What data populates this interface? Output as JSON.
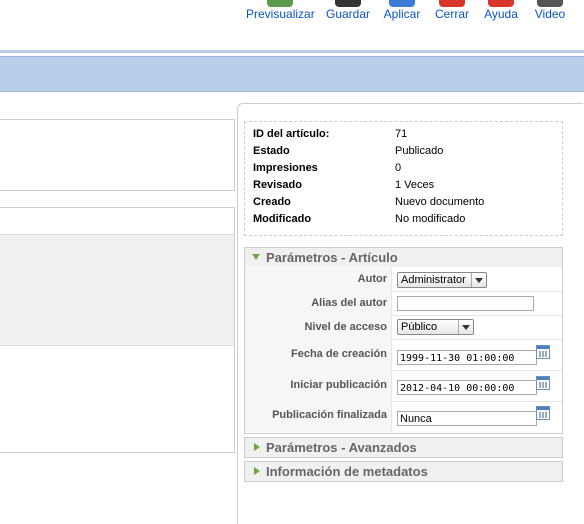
{
  "toolbar": {
    "buttons": [
      {
        "label": "Previsualizar",
        "icon": "preview-icon",
        "color": "#5a9a4a"
      },
      {
        "label": "Guardar",
        "icon": "save-icon",
        "color": "#333333"
      },
      {
        "label": "Aplicar",
        "icon": "apply-icon",
        "color": "#3a7bd5"
      },
      {
        "label": "Cerrar",
        "icon": "close-icon",
        "color": "#d9362b"
      },
      {
        "label": "Ayuda",
        "icon": "help-icon",
        "color": "#d9362b"
      },
      {
        "label": "Video",
        "icon": "video-icon",
        "color": "#555555"
      }
    ]
  },
  "info": {
    "rows": [
      {
        "key": "ID del artículo:",
        "value": "71"
      },
      {
        "key": "Estado",
        "value": "Publicado"
      },
      {
        "key": "Impresiones",
        "value": "0"
      },
      {
        "key": "Revisado",
        "value": "1 Veces"
      },
      {
        "key": "Creado",
        "value": "Nuevo documento"
      },
      {
        "key": "Modificado",
        "value": "No modificado"
      }
    ]
  },
  "params_article": {
    "title": "Parámetros - Artículo",
    "author_label": "Autor",
    "author_value": "Administrator",
    "alias_label": "Alias del autor",
    "alias_value": "",
    "access_label": "Nivel de acceso",
    "access_value": "Público",
    "created_label": "Fecha de creación",
    "created_value": "1999-11-30 01:00:00",
    "publish_up_label": "Iniciar publicación",
    "publish_up_value": "2012-04-10 00:00:00",
    "publish_down_label": "Publicación finalizada",
    "publish_down_value": "Nunca"
  },
  "params_advanced": {
    "title": "Parámetros - Avanzados"
  },
  "metadata": {
    "title": "Información de metadatos"
  },
  "colors": {
    "accent": "#0b55c4",
    "header_bar": "#b8cfe9",
    "arrow": "#6aa84f"
  }
}
